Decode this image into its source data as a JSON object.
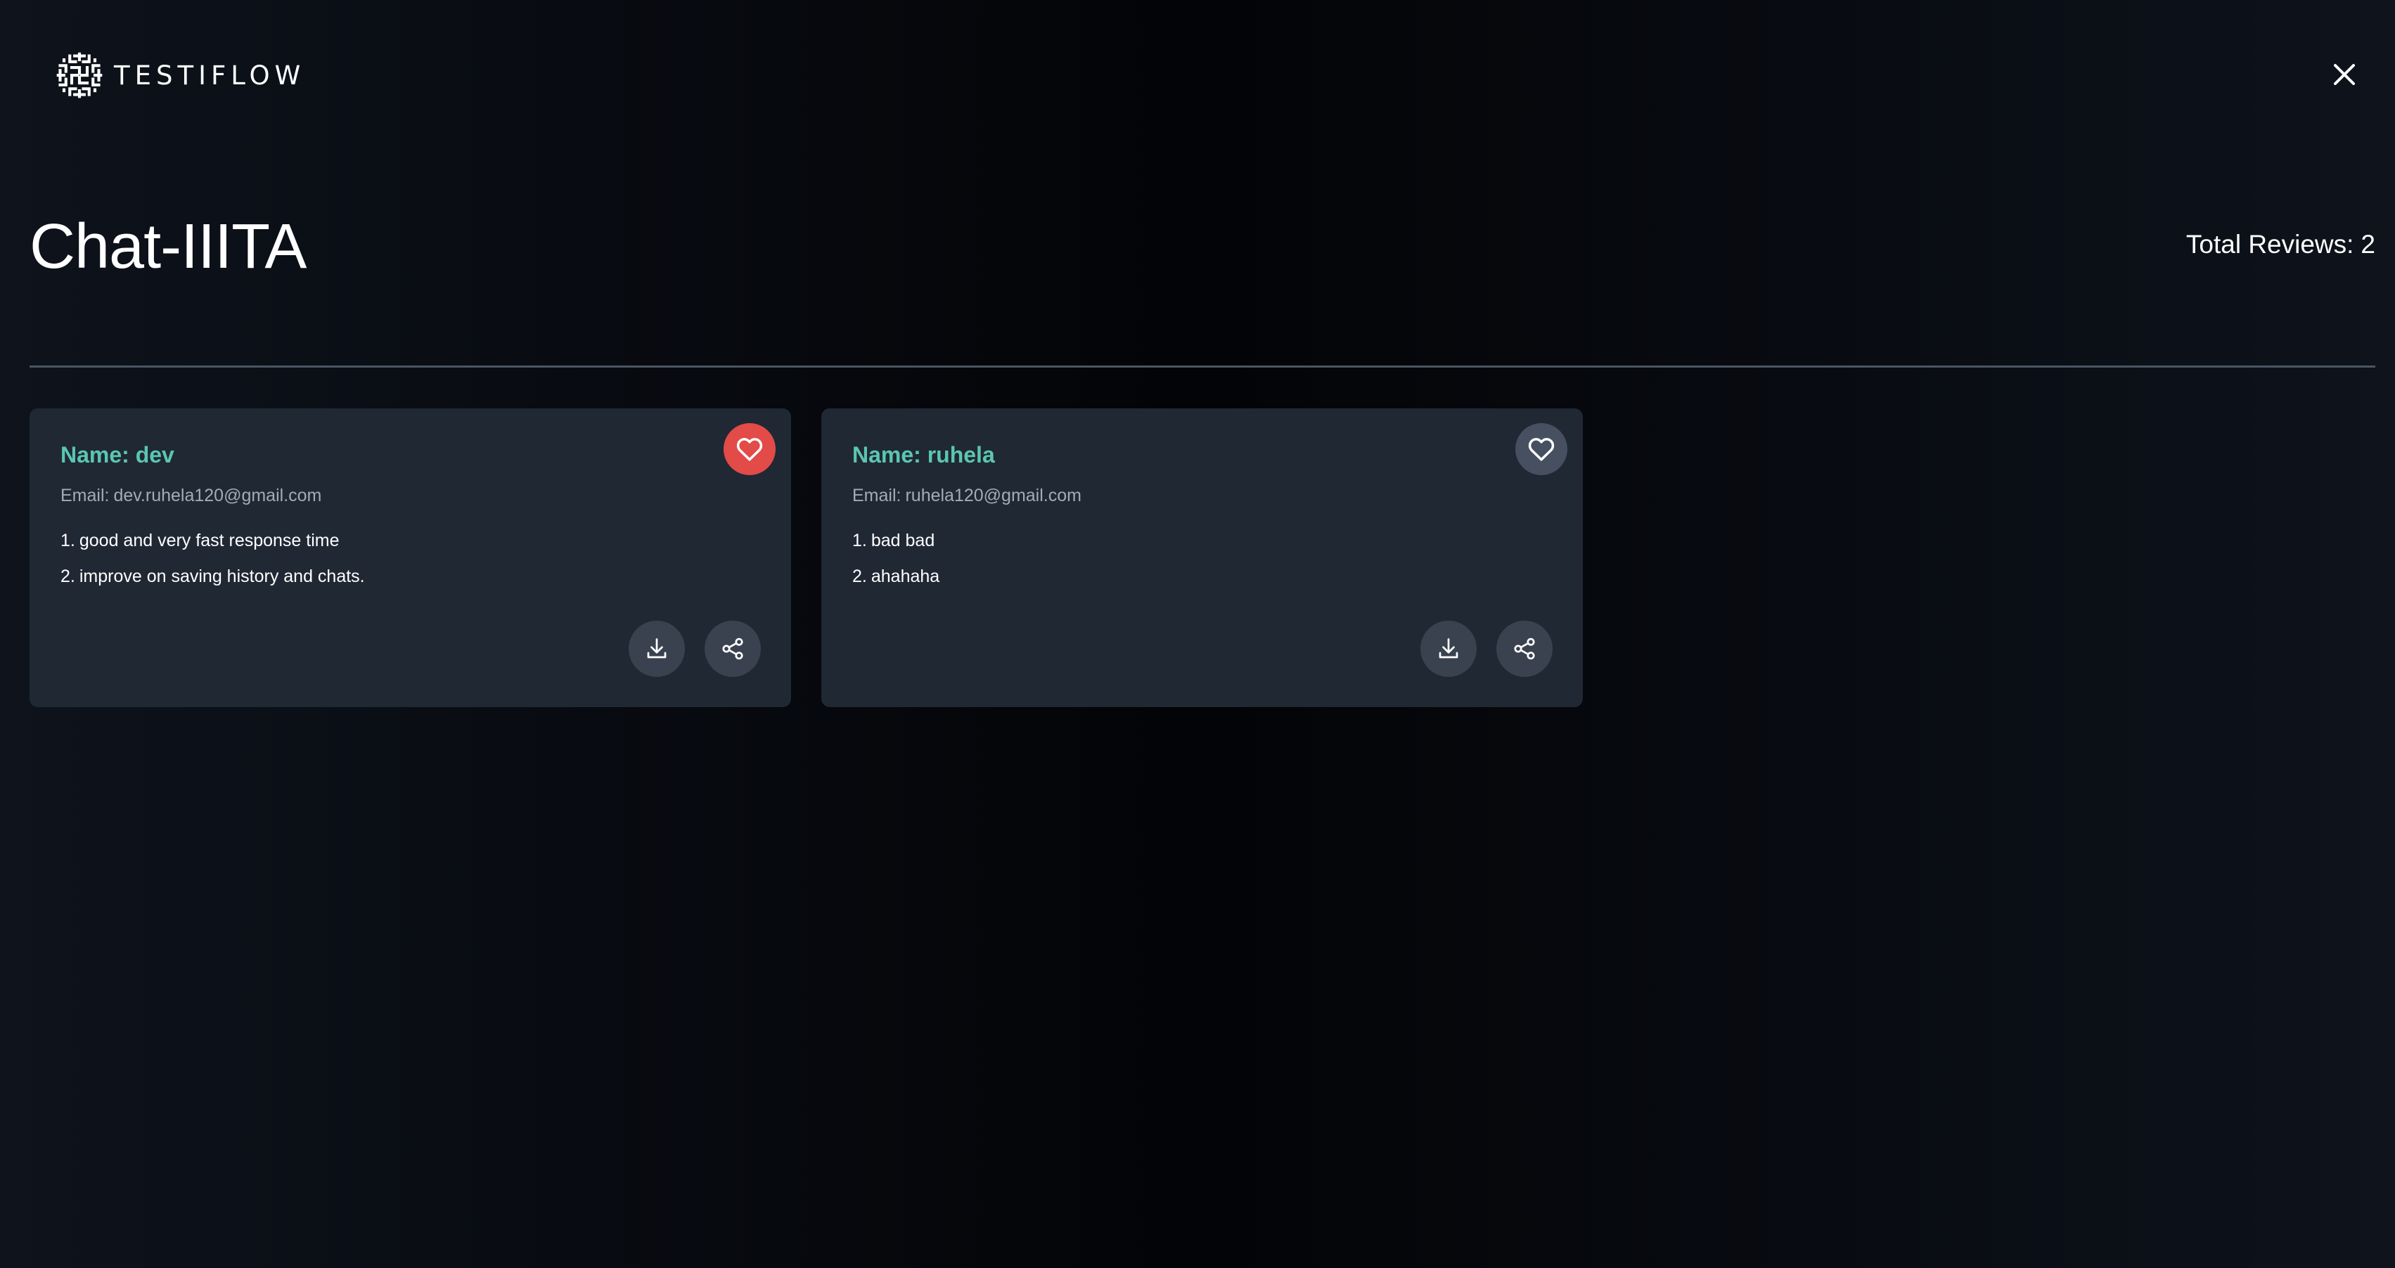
{
  "brand": {
    "name": "TESTIFLOW",
    "logo_icon": "maze-logo-icon"
  },
  "header": {
    "close_icon": "close-icon"
  },
  "page": {
    "title": "Chat-IIITA",
    "total_reviews_label": "Total Reviews:",
    "total_reviews_count": "2"
  },
  "colors": {
    "accent_name": "#5bc6b1",
    "favorite_active": "#e24b47",
    "card_background": "#202834"
  },
  "reviews": [
    {
      "name_label": "Name:",
      "name": "dev",
      "email_label": "Email:",
      "email": "dev.ruhela120@gmail.com",
      "points": [
        {
          "num": "1.",
          "text": "good and very fast response time"
        },
        {
          "num": "2.",
          "text": "improve on saving history and chats."
        }
      ],
      "favorited": true
    },
    {
      "name_label": "Name:",
      "name": "ruhela",
      "email_label": "Email:",
      "email": "ruhela120@gmail.com",
      "points": [
        {
          "num": "1.",
          "text": "bad bad"
        },
        {
          "num": "2.",
          "text": "ahahaha"
        }
      ],
      "favorited": false
    }
  ],
  "card_actions": {
    "favorite_icon": "heart-icon",
    "download_icon": "download-icon",
    "share_icon": "share-icon"
  }
}
